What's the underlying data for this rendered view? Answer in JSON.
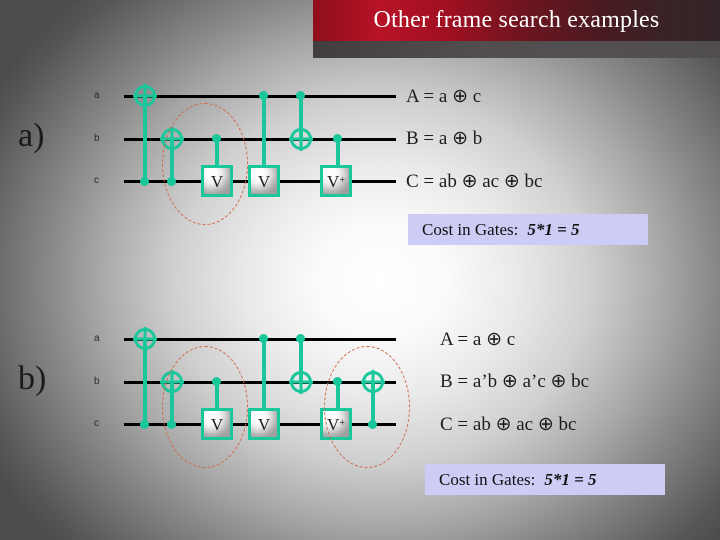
{
  "slide": {
    "title": "Other frame search examples"
  },
  "sections": [
    {
      "marker": "a)",
      "wire_labels": [
        "a",
        "b",
        "c"
      ],
      "gates": {
        "v_label": "V",
        "v_dagger_label": "V",
        "v_dagger_sup": "+"
      },
      "equations": [
        "A = a ⊕ c",
        "B = a ⊕ b",
        "C = ab ⊕ ac ⊕ bc"
      ],
      "cost": {
        "label": "Cost in Gates:",
        "value": "5*1 = 5"
      }
    },
    {
      "marker": "b)",
      "wire_labels": [
        "a",
        "b",
        "c"
      ],
      "gates": {
        "v_label": "V",
        "v_dagger_label": "V",
        "v_dagger_sup": "+"
      },
      "equations": [
        "A = a ⊕ c",
        "B = a’b ⊕ a’c ⊕ bc",
        "C = ab ⊕ ac ⊕ bc"
      ],
      "cost": {
        "label": "Cost in Gates:",
        "value": "5*1 = 5"
      }
    }
  ],
  "colors": {
    "gate_teal": "#19C79A",
    "wire_black": "#000000",
    "banner_red": "#B81227",
    "cost_lavender": "#CCCCF5",
    "ellipse_orange": "#D06A4A"
  }
}
